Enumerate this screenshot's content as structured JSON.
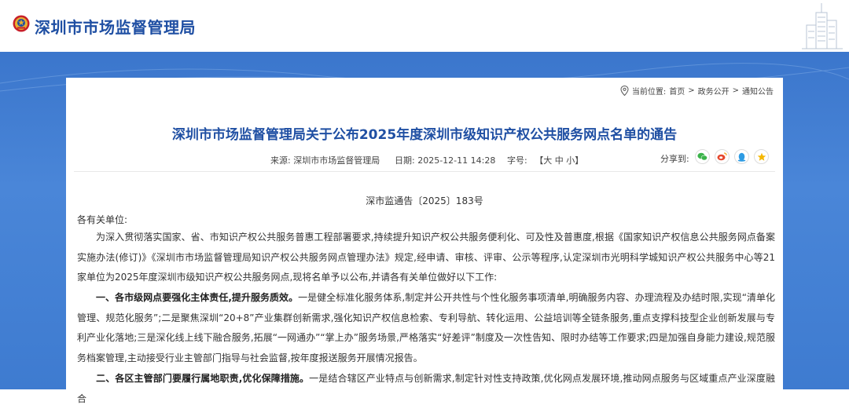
{
  "header": {
    "site_title": "深圳市市场监督管理局"
  },
  "breadcrumb": {
    "label": "当前位置:",
    "items": [
      "首页",
      "政务公开",
      "通知公告"
    ],
    "separator": ">"
  },
  "article": {
    "title": "深圳市市场监督管理局关于公布2025年度深圳市级知识产权公共服务网点名单的通告",
    "source_label": "来源:",
    "source_value": "深圳市市场监督管理局",
    "date_label": "日期:",
    "date_value": "2025-12-11 14:28",
    "font_label": "字号:",
    "font_open": "【",
    "font_large": "大",
    "font_medium": "中",
    "font_small": "小",
    "font_close": "】",
    "share_label": "分享到:",
    "doc_number": "深市监通告〔2025〕183号",
    "salutation": "各有关单位:",
    "intro": "为深入贯彻落实国家、省、市知识产权公共服务普惠工程部署要求,持续提升知识产权公共服务便利化、可及性及普惠度,根据《国家知识产权信息公共服务网点备案实施办法(修订)》《深圳市市场监督管理局知识产权公共服务网点管理办法》规定,经申请、审核、评审、公示等程序,认定深圳市光明科学城知识产权公共服务中心等21家单位为2025年度深圳市级知识产权公共服务网点,现将名单予以公布,并请各有关单位做好以下工作:",
    "item1_heading": "一、各市级网点要强化主体责任,提升服务质效。",
    "item1_body": "一是健全标准化服务体系,制定并公开共性与个性化服务事项清单,明确服务内容、办理流程及办结时限,实现“清单化管理、规范化服务”;二是聚焦深圳“20+8”产业集群创新需求,强化知识产权信息检索、专利导航、转化运用、公益培训等全链条服务,重点支撑科技型企业创新发展与专利产业化落地;三是深化线上线下融合服务,拓展“一网通办”“掌上办”服务场景,严格落实“好差评”制度及一次性告知、限时办结等工作要求;四是加强自身能力建设,规范服务档案管理,主动接受行业主管部门指导与社会监督,按年度报送服务开展情况报告。",
    "item2_heading": "二、各区主管部门要履行属地职责,优化保障措施。",
    "item2_body": "一是结合辖区产业特点与创新需求,制定针对性支持政策,优化网点发展环境,推动网点服务与区域重点产业深度融合"
  },
  "colors": {
    "title_blue": "#1f4fa3",
    "banner_blue": "#3e7bd0"
  }
}
